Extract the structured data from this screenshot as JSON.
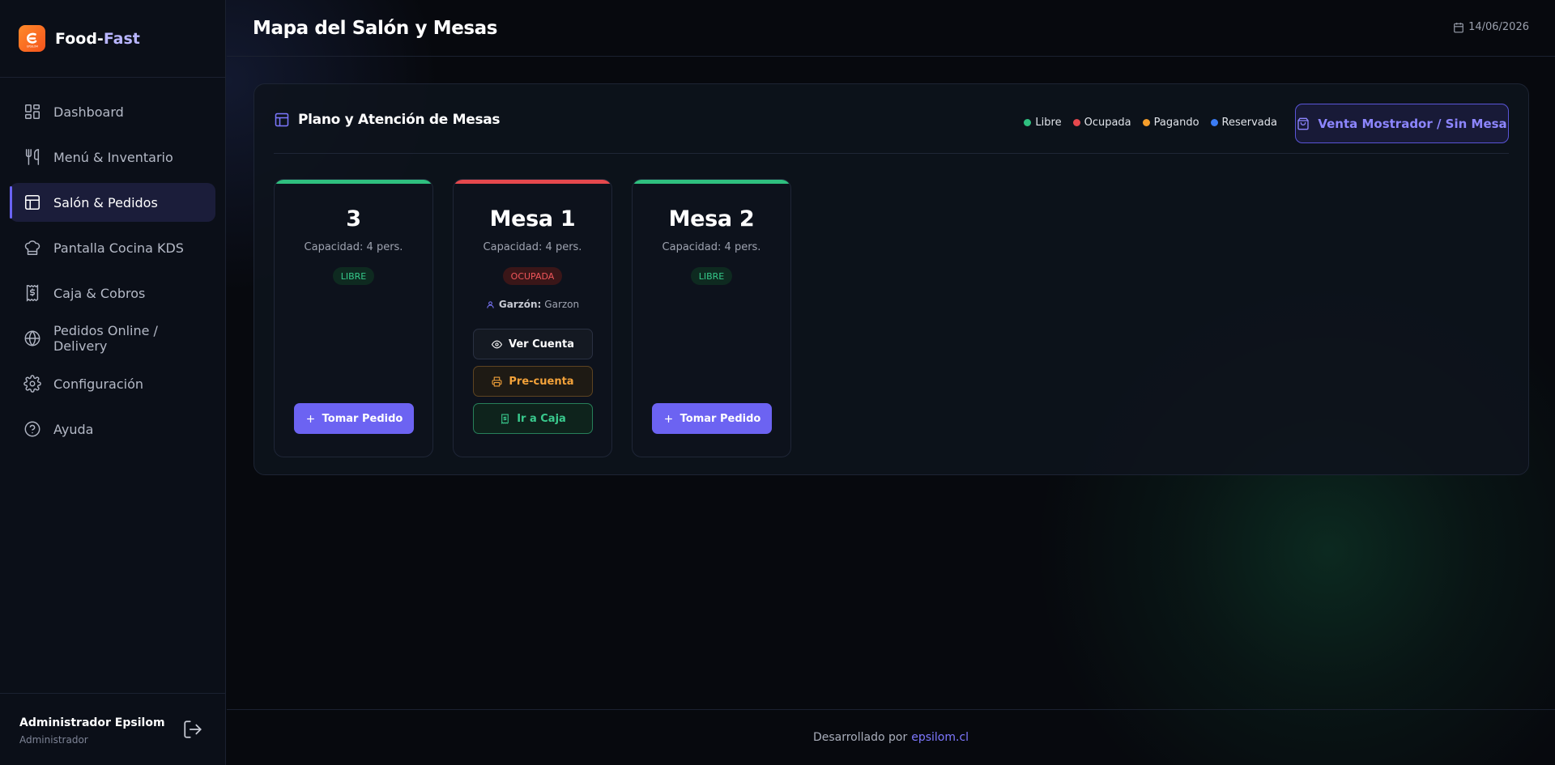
{
  "app": {
    "brand_part1": "Food-",
    "brand_part2": "Fast",
    "logo_text": "EPSILOM"
  },
  "sidebar": {
    "items": [
      {
        "label": "Dashboard",
        "icon": "dashboard-icon"
      },
      {
        "label": "Menú & Inventario",
        "icon": "utensils-icon"
      },
      {
        "label": "Salón & Pedidos",
        "icon": "layout-icon",
        "active": true
      },
      {
        "label": "Pantalla Cocina KDS",
        "icon": "chef-hat-icon"
      },
      {
        "label": "Caja & Cobros",
        "icon": "receipt-icon"
      },
      {
        "label": "Pedidos Online / Delivery",
        "icon": "globe-icon"
      },
      {
        "label": "Configuración",
        "icon": "gear-icon"
      },
      {
        "label": "Ayuda",
        "icon": "help-icon"
      }
    ],
    "user": {
      "name": "Administrador Epsilom",
      "role": "Administrador"
    }
  },
  "header": {
    "title": "Mapa del Salón y Mesas",
    "date": "14/06/2026"
  },
  "panel": {
    "title": "Plano y Atención de Mesas",
    "legend": [
      {
        "label": "Libre",
        "color": "#2fbf7f"
      },
      {
        "label": "Ocupada",
        "color": "#e5484d"
      },
      {
        "label": "Pagando",
        "color": "#f59e2b"
      },
      {
        "label": "Reservada",
        "color": "#3b7cf5"
      }
    ],
    "counter_button": "Venta Mostrador / Sin Mesa"
  },
  "tables": [
    {
      "name": "3",
      "capacity": "Capacidad: 4 pers.",
      "status": "LIBRE",
      "status_color": "#2fbf7f",
      "take_order": "Tomar Pedido"
    },
    {
      "name": "Mesa 1",
      "capacity": "Capacidad: 4 pers.",
      "status": "OCUPADA",
      "status_color": "#e5484d",
      "waiter_label": "Garzón:",
      "waiter_name": "Garzon",
      "view_bill": "Ver Cuenta",
      "pre_bill": "Pre-cuenta",
      "go_cashier": "Ir a Caja"
    },
    {
      "name": "Mesa 2",
      "capacity": "Capacidad: 4 pers.",
      "status": "LIBRE",
      "status_color": "#2fbf7f",
      "take_order": "Tomar Pedido"
    }
  ],
  "footer": {
    "text": "Desarrollado por",
    "link": "epsilom.cl"
  }
}
